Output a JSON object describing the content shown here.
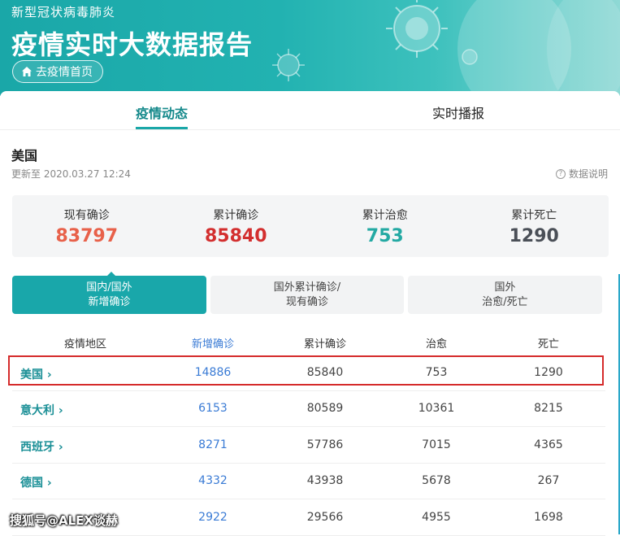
{
  "hero": {
    "subtitle": "新型冠状病毒肺炎",
    "title": "疫情实时大数据报告",
    "home_button": "去疫情首页"
  },
  "tabs": [
    {
      "label": "疫情动态",
      "active": true
    },
    {
      "label": "实时播报",
      "active": false
    }
  ],
  "region": {
    "name": "美国",
    "update_time": "更新至 2020.03.27 12:24",
    "data_note": "数据说明"
  },
  "summary": [
    {
      "label": "现有确诊",
      "value": "83797",
      "color": "#e8614a"
    },
    {
      "label": "累计确诊",
      "value": "85840",
      "color": "#d32f2f"
    },
    {
      "label": "累计治愈",
      "value": "753",
      "color": "#23a9a3"
    },
    {
      "label": "累计死亡",
      "value": "1290",
      "color": "#4a4f57"
    }
  ],
  "segments": [
    {
      "line1": "国内/国外",
      "line2": "新增确诊",
      "active": true
    },
    {
      "line1": "国外累计确诊/",
      "line2": "现有确诊",
      "active": false
    },
    {
      "line1": "国外",
      "line2": "治愈/死亡",
      "active": false
    }
  ],
  "table": {
    "headers": [
      "疫情地区",
      "新增确诊",
      "累计确诊",
      "治愈",
      "死亡"
    ],
    "rows": [
      {
        "region": "美国",
        "new": "14886",
        "total": "85840",
        "cured": "753",
        "dead": "1290"
      },
      {
        "region": "意大利",
        "new": "6153",
        "total": "80589",
        "cured": "10361",
        "dead": "8215"
      },
      {
        "region": "西班牙",
        "new": "8271",
        "total": "57786",
        "cured": "7015",
        "dead": "4365"
      },
      {
        "region": "德国",
        "new": "4332",
        "total": "43938",
        "cured": "5678",
        "dead": "267"
      },
      {
        "region": "",
        "new": "2922",
        "total": "29566",
        "cured": "4955",
        "dead": "1698"
      }
    ],
    "chevron": "›"
  },
  "watermark": "搜狐号@ALEX谈赫",
  "colors": {
    "accent": "#1aa7a8",
    "highlight_border": "#d52b2b",
    "link_blue": "#3a7bd5"
  }
}
